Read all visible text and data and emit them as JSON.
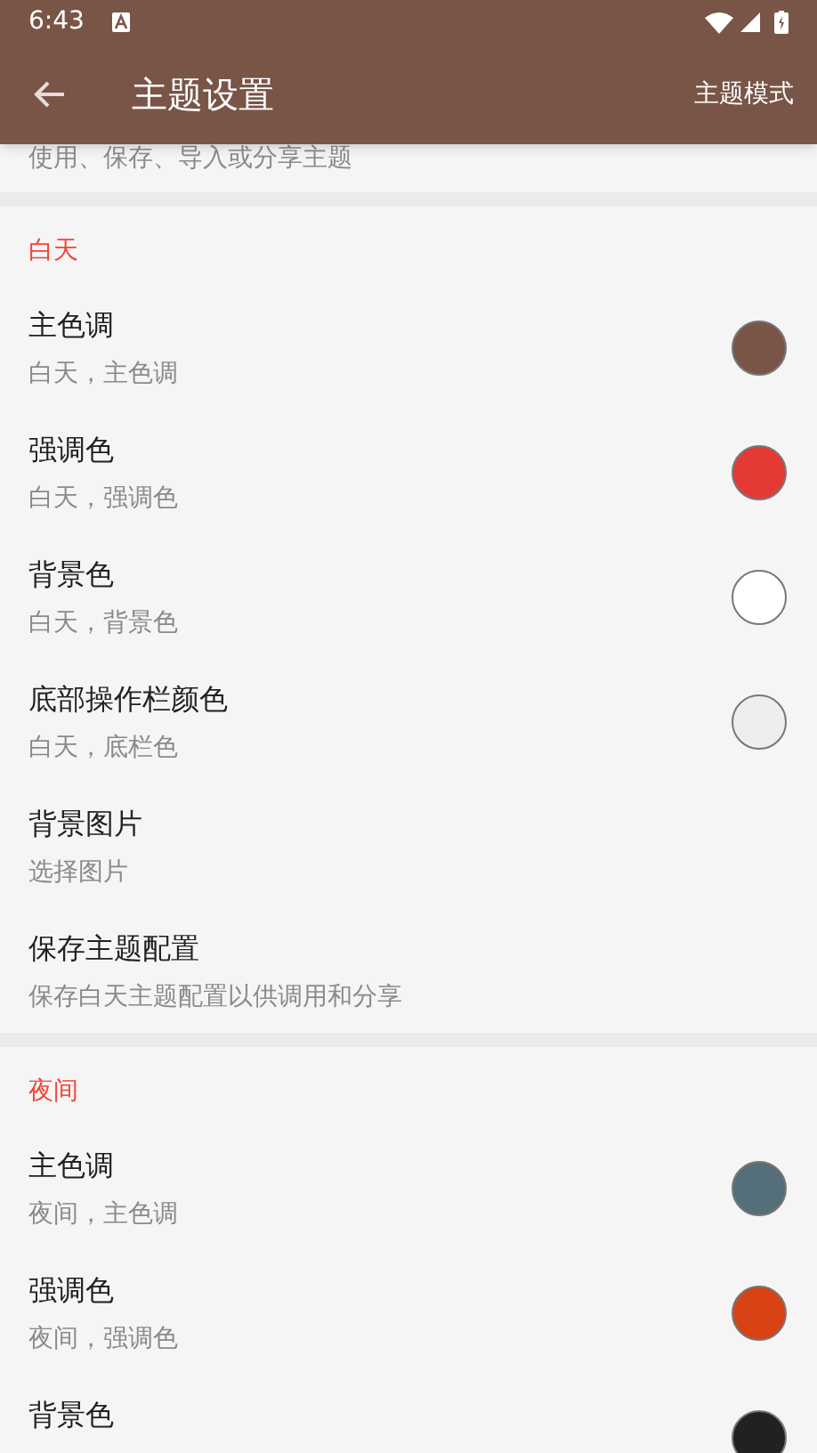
{
  "status_bar": {
    "time": "6:43"
  },
  "toolbar": {
    "title": "主题设置",
    "action": "主题模式"
  },
  "top_partial": {
    "subtitle": "使用、保存、导入或分享主题"
  },
  "sections": [
    {
      "header": "白天",
      "items": [
        {
          "kind": "color",
          "title": "主色调",
          "subtitle": "白天，主色调",
          "color": "#795548"
        },
        {
          "kind": "color",
          "title": "强调色",
          "subtitle": "白天，强调色",
          "color": "#e53935"
        },
        {
          "kind": "color",
          "title": "背景色",
          "subtitle": "白天，背景色",
          "color": "#ffffff"
        },
        {
          "kind": "color",
          "title": "底部操作栏颜色",
          "subtitle": "白天，底栏色",
          "color": "#eeeeee"
        },
        {
          "kind": "text",
          "title": "背景图片",
          "subtitle": "选择图片"
        },
        {
          "kind": "text",
          "title": "保存主题配置",
          "subtitle": "保存白天主题配置以供调用和分享"
        }
      ]
    },
    {
      "header": "夜间",
      "items": [
        {
          "kind": "color",
          "title": "主色调",
          "subtitle": "夜间，主色调",
          "color": "#546e7a"
        },
        {
          "kind": "color",
          "title": "强调色",
          "subtitle": "夜间，强调色",
          "color": "#d84315"
        },
        {
          "kind": "color",
          "title": "背景色",
          "color": "#212121"
        }
      ]
    }
  ]
}
